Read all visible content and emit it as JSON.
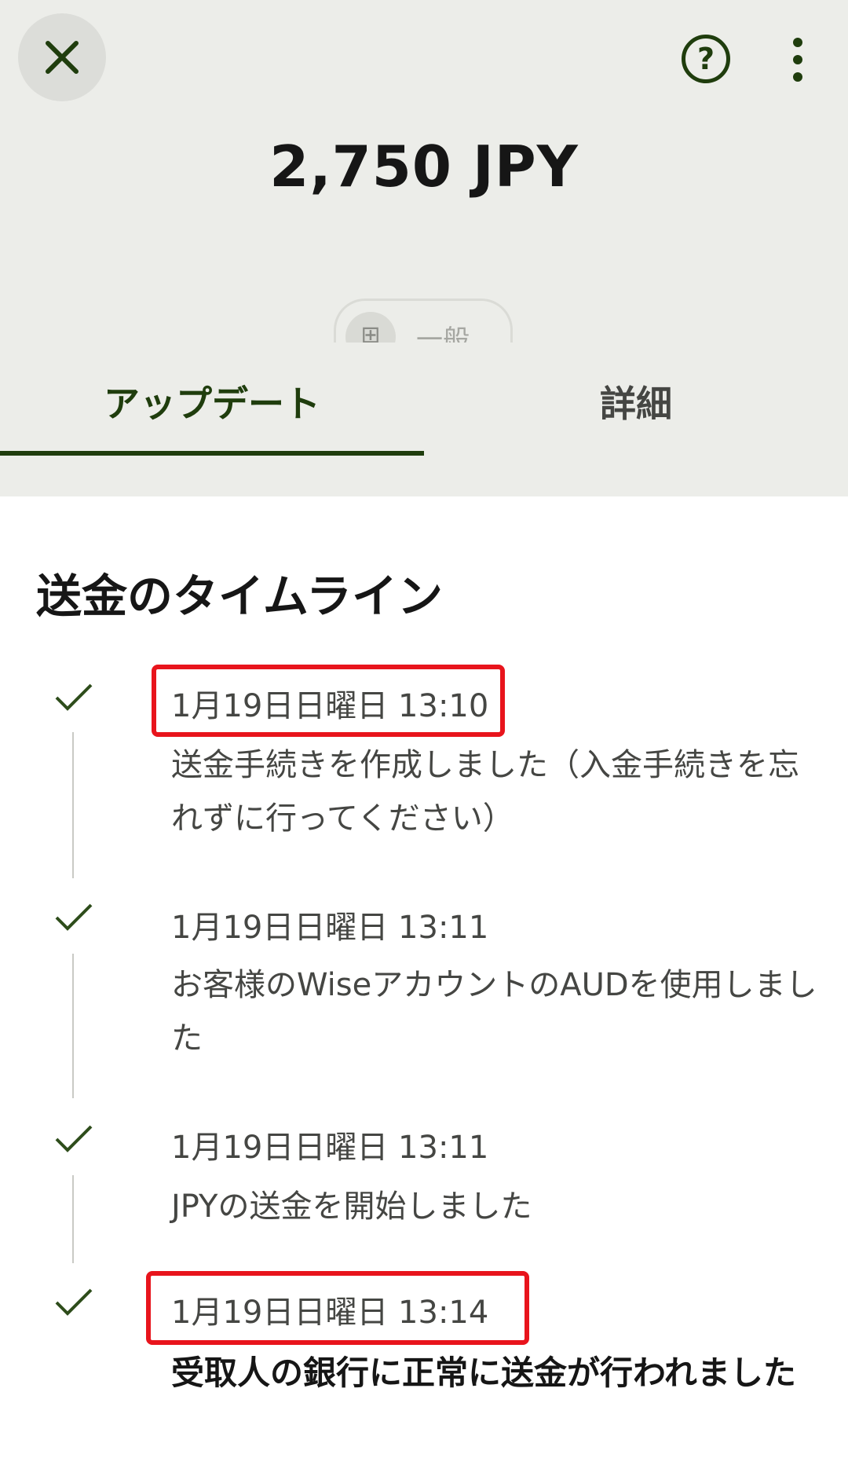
{
  "header": {
    "close_icon": "close-icon",
    "help_icon": "help-icon",
    "help_glyph": "?",
    "more_icon": "more-vertical-icon",
    "amount": "2,750 JPY",
    "category": {
      "icon": "grid-icon",
      "icon_glyph": "⊞",
      "label": "一般"
    },
    "background": "#ecede9",
    "accent": "#1f3d0d"
  },
  "tabs": [
    {
      "label": "アップデート",
      "active": true
    },
    {
      "label": "詳細",
      "active": false
    }
  ],
  "timeline": {
    "title": "送金のタイムライン",
    "events": [
      {
        "date": "1月19日日曜日 13:10",
        "text": "送金手続きを作成しました（入金手続きを忘れずに行ってください）",
        "highlighted": true
      },
      {
        "date": "1月19日日曜日 13:11",
        "text": "お客様のWiseアカウントのAUDを使用しました",
        "highlighted": false
      },
      {
        "date": "1月19日日曜日 13:11",
        "text": "JPYの送金を開始しました",
        "highlighted": false
      },
      {
        "date": "1月19日日曜日 13:14",
        "text": "受取人の銀行に正常に送金が行われました",
        "highlighted": true
      }
    ]
  },
  "colors": {
    "check": "#2e4d1b",
    "highlight": "#e8141c"
  }
}
